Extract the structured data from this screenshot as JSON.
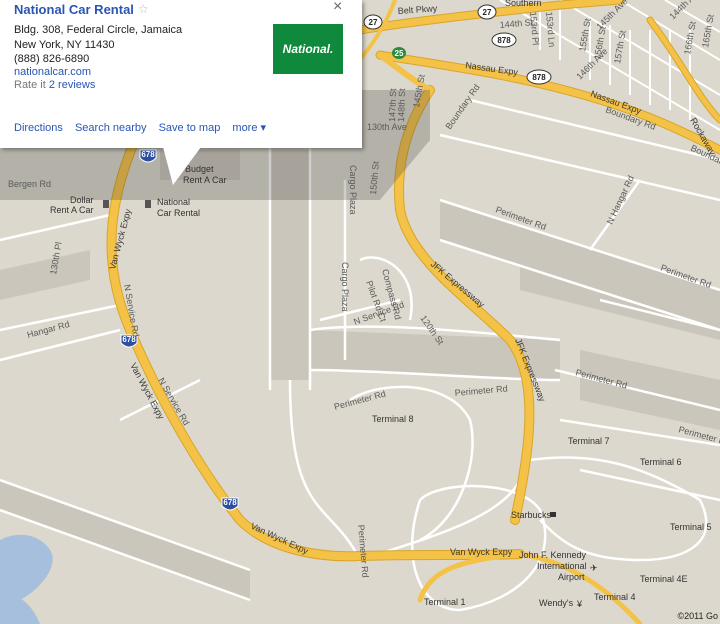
{
  "info_window": {
    "title": "National Car Rental",
    "star_icon": "☆",
    "close_icon": "×",
    "address_line1": "Bldg. 308, Federal Circle, Jamaica",
    "address_line2": "New York, NY 11430",
    "phone": "(888) 826-6890",
    "website": "nationalcar.com",
    "rate_prefix": "Rate it",
    "reviews": "2 reviews",
    "logo_text": "National.",
    "actions": [
      "Directions",
      "Search nearby",
      "Save to map",
      "more ▾"
    ]
  },
  "roads": {
    "belt_pkwy": "Belt Pkwy",
    "nassau_expy_1": "Nassau Expy",
    "nassau_expy_2": "Nassau Expy",
    "boundary_rd_1": "Boundary Rd",
    "boundary_rd_2": "Boundary Rd",
    "van_wyck_1": "Van Wyck Expy",
    "van_wyck_2": "Van Wyck Expy",
    "van_wyck_3": "Van Wyck Expy",
    "van_wyck_4": "Van Wyck Expy",
    "jfk_expy_1": "JFK Expressway",
    "jfk_expy_2": "JFK Expressway",
    "rockaway": "Rockaway",
    "bergen_rd": "Bergen Rd",
    "hangar_rd_1": "Hangar Rd",
    "hangar_rd_2": "N Hangar Rd",
    "perimeter_1": "Perimeter Rd",
    "perimeter_2": "Perimeter Rd",
    "perimeter_3": "Perimeter Rd",
    "perimeter_4": "Perimeter Rd",
    "perimeter_5": "Perimeter Rd",
    "perimeter_6": "Perimeter Rd",
    "perimeter_7": "Perimeter Rd",
    "n_service_1": "N Service Rd",
    "n_service_2": "N Service Rd",
    "n_service_3": "N Service Rd",
    "cargo_plaza_1": "Cargo Plaza",
    "cargo_plaza_2": "Cargo Plaza",
    "compass_rd": "Compass Rd",
    "pilot_rd": "Pilot Rd Ct",
    "st_130": "130th Pl",
    "st_150": "150th St",
    "st_148": "148th St",
    "st_147": "147th St",
    "st_145": "145th St",
    "st_144": "144th St",
    "st_120": "120th St",
    "ave_130": "130th Ave",
    "ave_146": "146th Ave",
    "ave_145": "145th Ave",
    "ave_144": "144th Ave",
    "st_153": "153rd Pl",
    "st_153l": "153rd Ln",
    "st_155": "155th St",
    "st_156": "156th St",
    "st_157": "157th St",
    "st_166": "166th St",
    "st_165": "165th St",
    "southern": "Southern"
  },
  "shields": {
    "s27a": "27",
    "s27b": "27",
    "s878a": "878",
    "s878b": "878",
    "s878c": "878",
    "s678a": "678",
    "s678b": "678",
    "s678c": "678",
    "s25": "25"
  },
  "places": {
    "dollar": "Dollar Rent A Car",
    "dollar_1": "Dollar",
    "dollar_2": "Rent A Car",
    "budget": "Budget Rent A Car",
    "budget_1": "Budget",
    "budget_2": "Rent A Car",
    "national_1": "National",
    "national_2": "Car Rental",
    "terminal_8": "Terminal 8",
    "terminal_7": "Terminal 7",
    "terminal_6": "Terminal 6",
    "terminal_5": "Terminal 5",
    "terminal_4e": "Terminal 4E",
    "terminal_4": "Terminal 4",
    "terminal_1": "Terminal 1",
    "starbucks": "Starbucks",
    "wendys": "Wendy's",
    "jfk_1": "John F. Kennedy",
    "jfk_2": "International",
    "jfk_3": "Airport",
    "van_wyck_5": "Van Wyck Expy"
  },
  "copyright": "©2011 Go",
  "colors": {
    "land": "#ddd8cd",
    "water": "#a5bfdd",
    "highway": "#f4c246",
    "highway_edge": "#d8a529",
    "street": "#ffffff",
    "runway": "#c8c3b8"
  }
}
